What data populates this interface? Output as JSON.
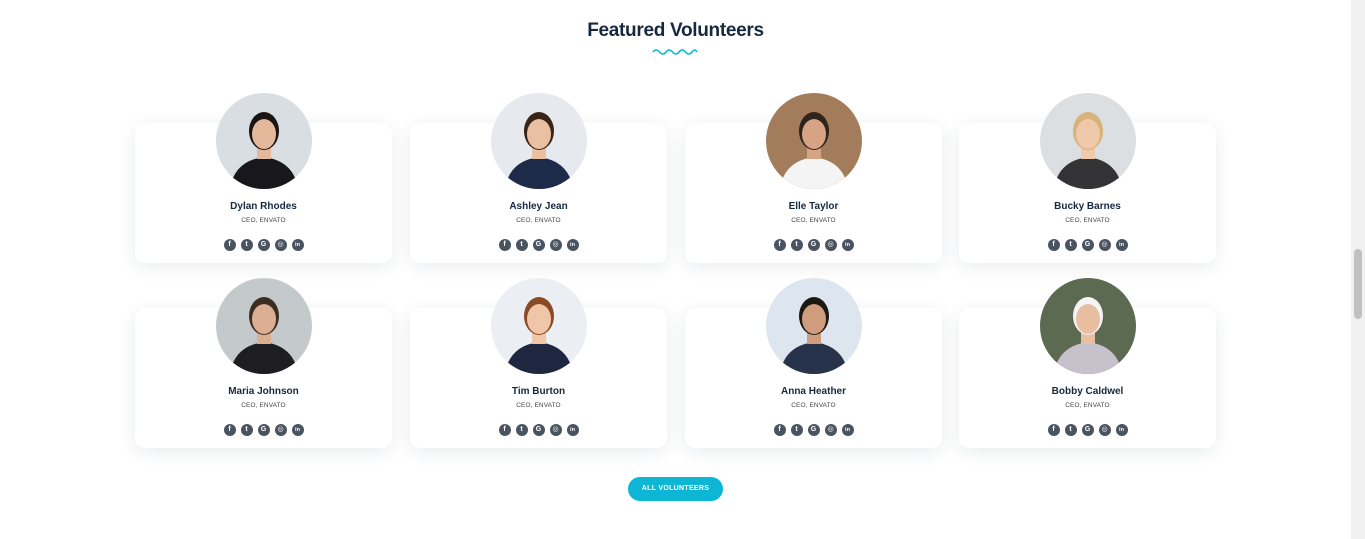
{
  "section": {
    "title": "Featured Volunteers"
  },
  "volunteers": [
    {
      "name": "Dylan Rhodes",
      "role": "CEO, ENVATO",
      "hair": "#1a1412",
      "skin": "#e4b89a",
      "suit": "#18181c",
      "bg": "#d9dee2"
    },
    {
      "name": "Ashley Jean",
      "role": "CEO, ENVATO",
      "hair": "#3a2418",
      "skin": "#eac0a2",
      "suit": "#1d2a4a",
      "bg": "#e6eaee"
    },
    {
      "name": "Elle Taylor",
      "role": "CEO, ENVATO",
      "hair": "#2e241d",
      "skin": "#d7a384",
      "suit": "#f4f4f4",
      "bg": "#a37c5c"
    },
    {
      "name": "Bucky Barnes",
      "role": "CEO, ENVATO",
      "hair": "#d7b27a",
      "skin": "#f0c8aa",
      "suit": "#333335",
      "bg": "#dcdfe2"
    },
    {
      "name": "Maria Johnson",
      "role": "CEO, ENVATO",
      "hair": "#3b2d22",
      "skin": "#dcaf92",
      "suit": "#1e1e22",
      "bg": "#c4c9cc"
    },
    {
      "name": "Tim Burton",
      "role": "CEO, ENVATO",
      "hair": "#8a4a26",
      "skin": "#f0c6a8",
      "suit": "#1e2640",
      "bg": "#ebeff3"
    },
    {
      "name": "Anna Heather",
      "role": "CEO, ENVATO",
      "hair": "#1c1814",
      "skin": "#cf9d7e",
      "suit": "#27334a",
      "bg": "#dde6ee"
    },
    {
      "name": "Bobby Caldwel",
      "role": "CEO, ENVATO",
      "hair": "#f4f4f6",
      "skin": "#e7bea0",
      "suit": "#c7c1cc",
      "bg": "#5d6a52"
    }
  ],
  "socials": [
    {
      "icon": "facebook-icon",
      "glyph": "f"
    },
    {
      "icon": "twitter-icon",
      "glyph": "t"
    },
    {
      "icon": "google-icon",
      "glyph": "G"
    },
    {
      "icon": "instagram-icon",
      "glyph": "◎"
    },
    {
      "icon": "linkedin-icon",
      "glyph": "in"
    }
  ],
  "button": {
    "label": "ALL VOLUNTEERS"
  },
  "colors": {
    "accent": "#0eb6d6",
    "heading": "#17293f",
    "social": "#4a5360"
  }
}
